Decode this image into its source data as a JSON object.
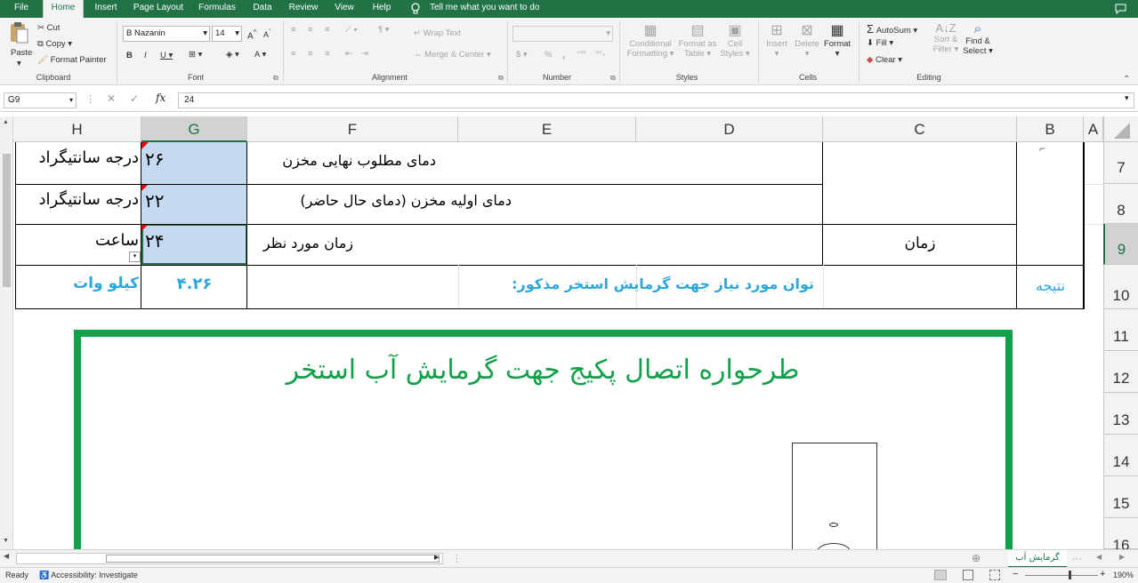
{
  "menu_tabs": [
    "File",
    "Home",
    "Insert",
    "Page Layout",
    "Formulas",
    "Data",
    "Review",
    "View",
    "Help"
  ],
  "tell_me": "Tell me what you want to do",
  "ribbon": {
    "clipboard": {
      "paste": "Paste",
      "cut": "Cut",
      "copy": "Copy",
      "format_painter": "Format Painter",
      "label": "Clipboard"
    },
    "font": {
      "name": "B Nazanin",
      "size": "14",
      "label": "Font"
    },
    "alignment": {
      "wrap": "Wrap Text",
      "merge": "Merge & Center",
      "label": "Alignment"
    },
    "number": {
      "label": "Number"
    },
    "styles": {
      "cond": "Conditional",
      "cond2": "Formatting",
      "table": "Format as",
      "table2": "Table",
      "cell": "Cell",
      "cell2": "Styles",
      "label": "Styles"
    },
    "cells": {
      "insert": "Insert",
      "delete": "Delete",
      "format": "Format",
      "label": "Cells"
    },
    "editing": {
      "autosum": "AutoSum",
      "fill": "Fill",
      "clear": "Clear",
      "sort": "Sort &",
      "sort2": "Filter",
      "find": "Find &",
      "find2": "Select",
      "label": "Editing"
    }
  },
  "formula_bar": {
    "name_box": "G9",
    "value": "24"
  },
  "columns": [
    "H",
    "G",
    "F",
    "E",
    "D",
    "C",
    "B",
    "A"
  ],
  "rows": [
    "7",
    "8",
    "9",
    "10",
    "11",
    "12",
    "13",
    "14",
    "15",
    "16"
  ],
  "cells": {
    "h7": "درجه سانتیگراد",
    "g7": "۲۶",
    "f7": "دمای مطلوب نهایی مخزن",
    "h8": "درجه سانتیگراد",
    "g8": "۲۲",
    "f8": "دمای اولیه مخزن (دمای حال حاضر)",
    "h9": "ساعت",
    "g9": "۲۴",
    "f9": "زمان مورد نظر",
    "c9": "زمان",
    "h10": "کیلو وات",
    "g10": "۴.۲۶",
    "f10": "توان مورد نیاز جهت گرمایش استخر مذکور:",
    "b10": "نتیجه"
  },
  "diagram_title": "طرحواره اتصال پکیج جهت گرمایش آب استخر",
  "sheet_tab": "گرمایش آب",
  "status": {
    "ready": "Ready",
    "accessibility": "Accessibility: Investigate",
    "zoom": "190%"
  },
  "colors": {
    "excel_green": "#217346",
    "frame_green": "#12a14b",
    "result_blue": "#2ba7dd",
    "selection": "#c5daf0"
  }
}
